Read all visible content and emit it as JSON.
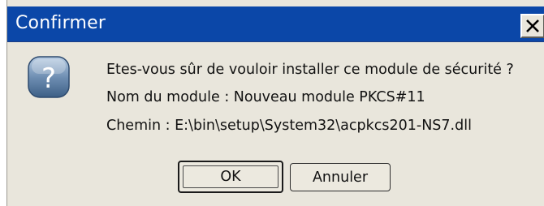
{
  "window": {
    "title": "Confirmer",
    "close_glyph": "X",
    "titlebar_color": "#0b47a8",
    "background_color": "#e9e6dc"
  },
  "icon": {
    "name": "question-icon",
    "glyph": "?"
  },
  "message": {
    "line1": "Etes-vous sûr de vouloir installer ce module de sécurité ?",
    "line2": "Nom du module : Nouveau module PKCS#11",
    "line3": "Chemin : E:\\bin\\setup\\System32\\acpkcs201-NS7.dll"
  },
  "buttons": {
    "ok_label": "OK",
    "cancel_label": "Annuler"
  }
}
